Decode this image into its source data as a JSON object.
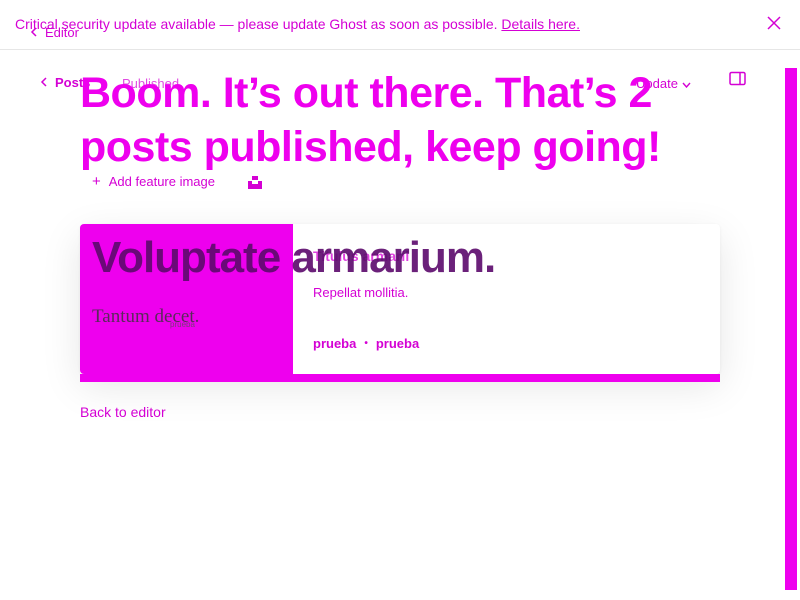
{
  "banner": {
    "message": "Critical security update available — please update Ghost as soon as possible.",
    "link": "Details here."
  },
  "editor_back": "Editor",
  "toolbar": {
    "back_label": "Posts",
    "status": "Published",
    "update_label": "Update"
  },
  "headline": {
    "line1": "Boom. It’s out there. That’s 2",
    "line2": "posts published, keep going!"
  },
  "feature": {
    "add_label": "Add feature image"
  },
  "card": {
    "image_caption": "Tantum decet.",
    "image_sub": "prueba",
    "overlay_title": "Voluptate armarium.",
    "title": "Titulus armarii",
    "excerpt": "Repellat mollitia.",
    "author": "prueba",
    "tag": "prueba"
  },
  "back_link": "Back to editor",
  "icons": {
    "close": "close-icon",
    "chevron_left": "chevron-left-icon",
    "chevron_down": "chevron-down-icon",
    "sidebar": "sidebar-toggle-icon",
    "plus": "plus-icon",
    "unsplash": "unsplash-icon"
  },
  "colors": {
    "accent": "#ee00ee",
    "text": "#d400d4",
    "overlay_title": "#5c0a6c"
  }
}
